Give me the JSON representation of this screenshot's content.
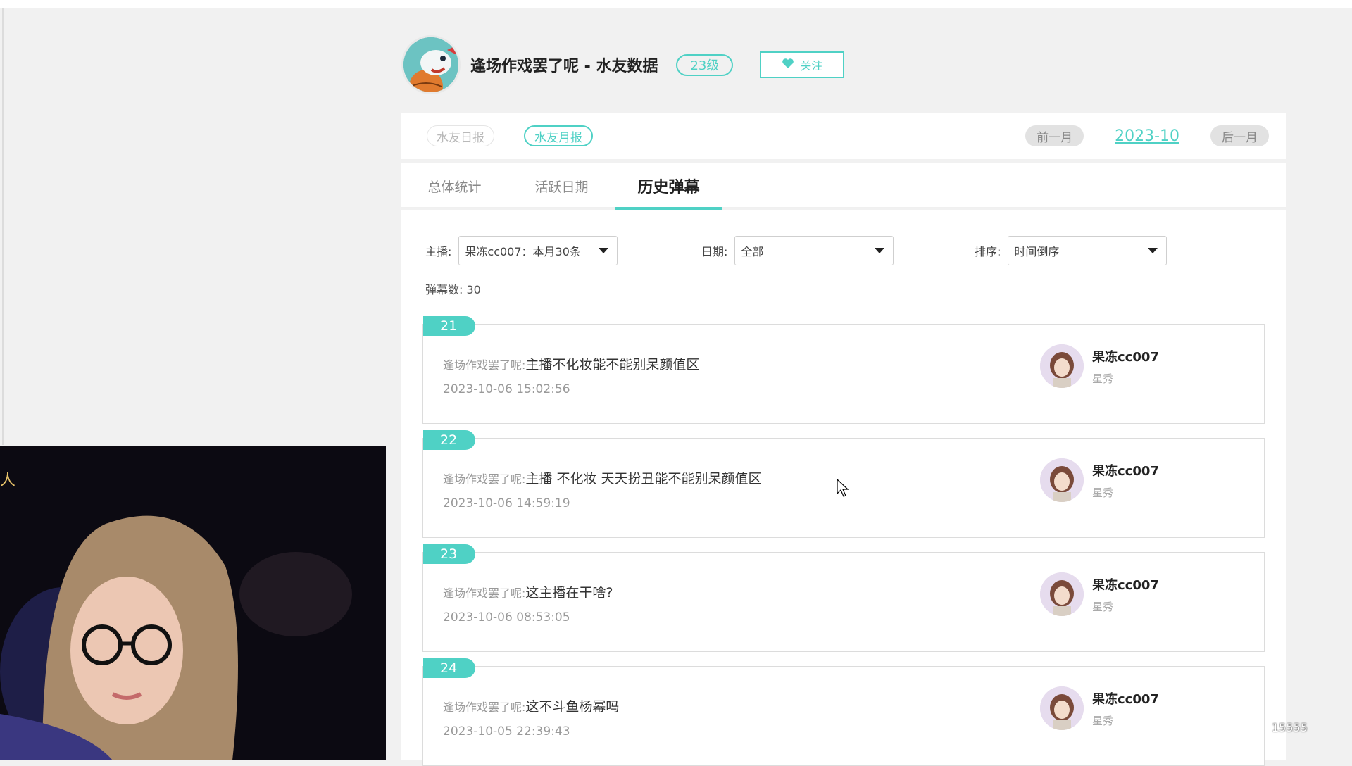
{
  "header": {
    "title": "逢场作戏罢了呢 - 水友数据",
    "level": "23级",
    "follow_label": "关注"
  },
  "report_switch": {
    "daily": "水友日报",
    "monthly": "水友月报",
    "prev_month": "前一月",
    "current_month": "2023-10",
    "next_month": "后一月"
  },
  "tabs": [
    {
      "label": "总体统计"
    },
    {
      "label": "活跃日期"
    },
    {
      "label": "历史弹幕"
    }
  ],
  "filters": {
    "anchor_label": "主播:",
    "anchor_value": "果冻cc007：本月30条",
    "date_label": "日期:",
    "date_value": "全部",
    "sort_label": "排序:",
    "sort_value": "时间倒序"
  },
  "count_text": "弹幕数:  30",
  "messages": [
    {
      "index": "21",
      "user": "逢场作戏罢了呢:",
      "text": "主播不化妆能不能别呆颜值区",
      "time": "2023-10-06 15:02:56",
      "anchor": "果冻cc007",
      "platform": "星秀"
    },
    {
      "index": "22",
      "user": "逢场作戏罢了呢:",
      "text": "主播 不化妆 天天扮丑能不能别呆颜值区",
      "time": "2023-10-06 14:59:19",
      "anchor": "果冻cc007",
      "platform": "星秀"
    },
    {
      "index": "23",
      "user": "逢场作戏罢了呢:",
      "text": "这主播在干啥?",
      "time": "2023-10-06 08:53:05",
      "anchor": "果冻cc007",
      "platform": "星秀"
    },
    {
      "index": "24",
      "user": "逢场作戏罢了呢:",
      "text": "这不斗鱼杨幂吗",
      "time": "2023-10-05 22:39:43",
      "anchor": "果冻cc007",
      "platform": "星秀"
    }
  ],
  "overlay": {
    "webcam_caption": "人",
    "watermark": "15555"
  },
  "colors": {
    "accent": "#4fd1c5",
    "background": "#f1f1f1"
  }
}
